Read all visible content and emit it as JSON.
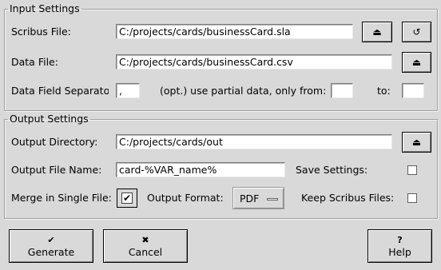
{
  "input_settings": {
    "legend": "Input Settings",
    "scribus_file_label": "Scribus File:",
    "scribus_file_value": "C:/projects/cards/businessCard.sla",
    "data_file_label": "Data File:",
    "data_file_value": "C:/projects/cards/businessCard.csv",
    "separator_label": "Data Field Separator:",
    "separator_value": ",",
    "partial_label": "(opt.) use partial data, only from:",
    "from_value": "",
    "to_label": "to:",
    "to_value": ""
  },
  "output_settings": {
    "legend": "Output Settings",
    "output_dir_label": "Output Directory:",
    "output_dir_value": "C:/projects/cards/out",
    "output_name_label": "Output File Name:",
    "output_name_value": "card-%VAR_name%",
    "save_settings_label": "Save Settings:",
    "save_settings_checked": false,
    "merge_label": "Merge in Single File:",
    "merge_checked": true,
    "format_label": "Output Format:",
    "format_value": "PDF",
    "keep_files_label": "Keep Scribus Files:",
    "keep_files_checked": false
  },
  "icons": {
    "eject": "⏏",
    "reload": "↺",
    "check": "✔",
    "cross": "✖",
    "question": "?"
  },
  "buttons": {
    "generate": "Generate",
    "cancel": "Cancel",
    "help": "Help"
  }
}
